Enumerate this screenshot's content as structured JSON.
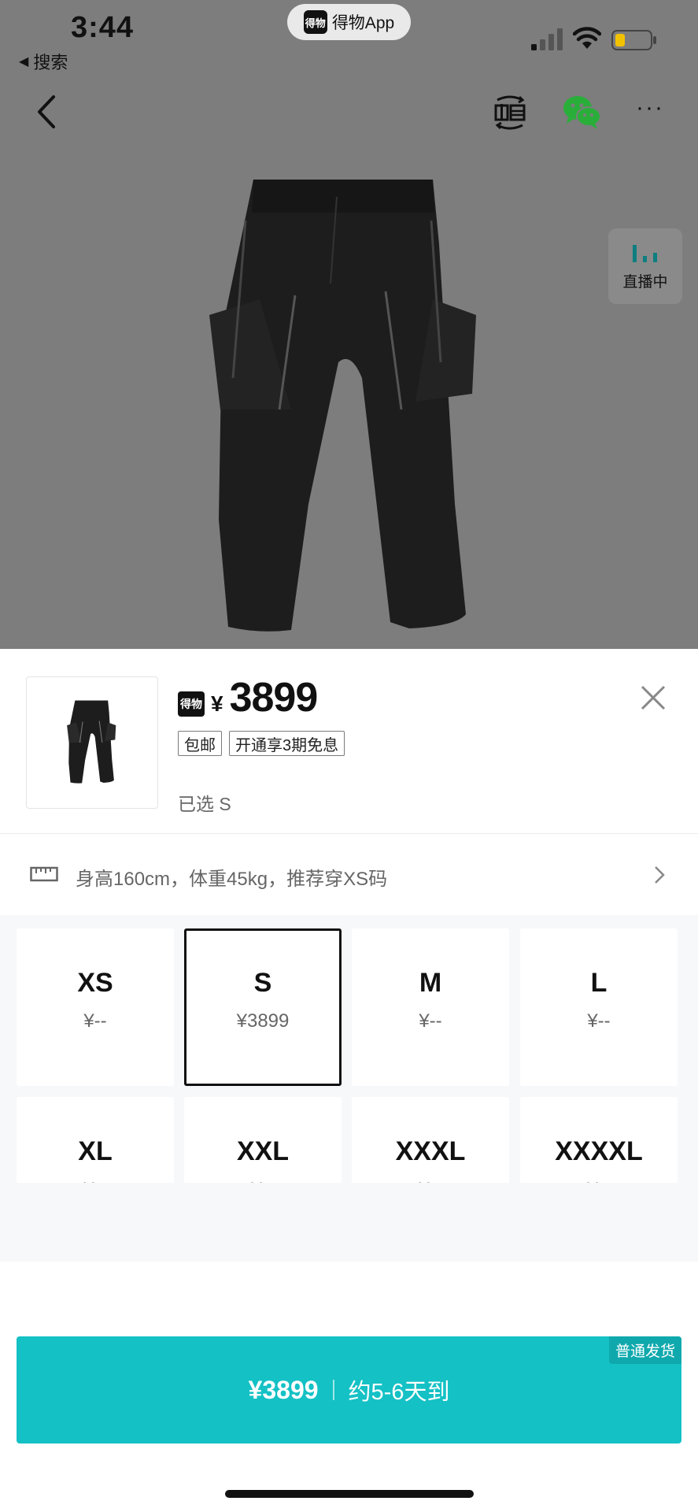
{
  "status_bar": {
    "time": "3:44",
    "back_label": "搜索",
    "app_name": "得物App",
    "app_logo_text": "得物"
  },
  "live": {
    "label": "直播中"
  },
  "product": {
    "logo_text": "得物",
    "currency": "¥",
    "price": "3899",
    "tags": [
      "包邮",
      "开通享3期免息"
    ],
    "selected_text": "已选 S"
  },
  "size_recommendation": {
    "text": "身高160cm，体重45kg，推荐穿XS码"
  },
  "sizes": [
    {
      "label": "XS",
      "price": "¥--",
      "selected": false
    },
    {
      "label": "S",
      "price": "¥3899",
      "selected": true
    },
    {
      "label": "M",
      "price": "¥--",
      "selected": false
    },
    {
      "label": "L",
      "price": "¥--",
      "selected": false
    },
    {
      "label": "XL",
      "price": "¥--",
      "selected": false
    },
    {
      "label": "XXL",
      "price": "¥--",
      "selected": false
    },
    {
      "label": "XXXL",
      "price": "¥--",
      "selected": false
    },
    {
      "label": "XXXXL",
      "price": "¥--",
      "selected": false
    }
  ],
  "buy": {
    "price": "¥3899",
    "eta": "约5-6天到",
    "shipping_badge": "普通发货"
  },
  "colors": {
    "accent": "#14c1c5",
    "accent_dark": "#0fa9ad",
    "overlay": "#7d7d7d",
    "wechat": "#2aae3a",
    "live_teal": "#0e7e80"
  }
}
